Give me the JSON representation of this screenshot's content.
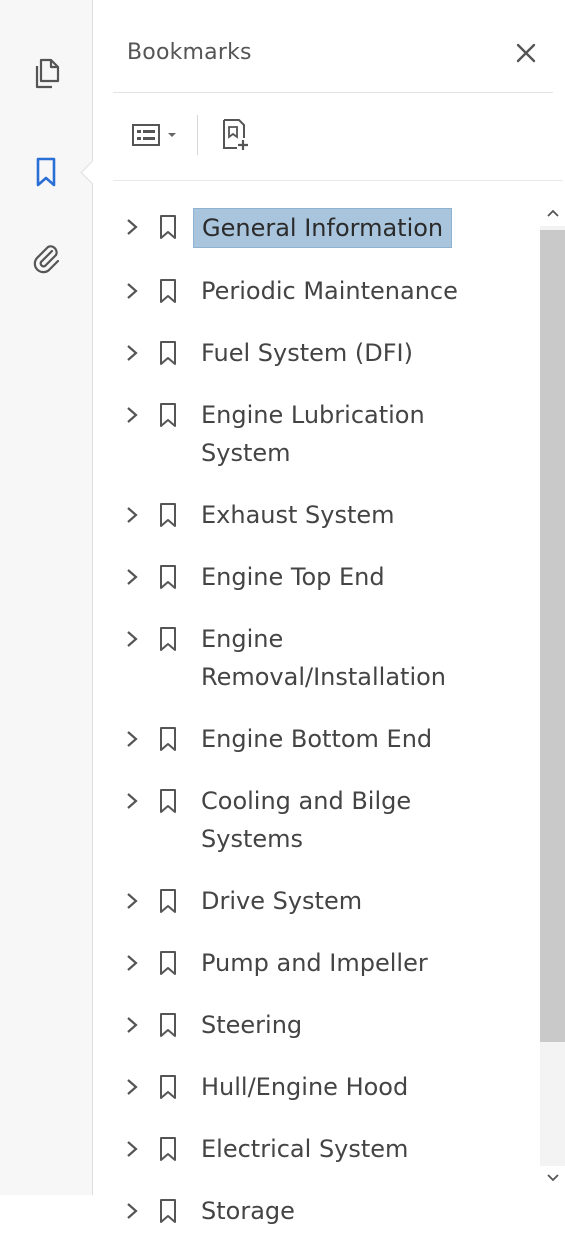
{
  "rail": {
    "items": [
      {
        "icon": "page-thumbnails-icon",
        "active": false
      },
      {
        "icon": "bookmark-icon",
        "active": true,
        "color": "#2a6fd6"
      },
      {
        "icon": "attachment-icon",
        "active": false
      }
    ]
  },
  "panel": {
    "title": "Bookmarks",
    "close_icon": "close-icon"
  },
  "toolbar": {
    "options_icon": "list-options-icon",
    "add_icon": "new-bookmark-icon"
  },
  "bookmarks": [
    {
      "label": "General Information",
      "selected": true
    },
    {
      "label": "Periodic Maintenance"
    },
    {
      "label": "Fuel System (DFI)"
    },
    {
      "label": "Engine Lubrication System"
    },
    {
      "label": "Exhaust System"
    },
    {
      "label": "Engine Top End"
    },
    {
      "label": "Engine Removal/Installation"
    },
    {
      "label": "Engine Bottom End"
    },
    {
      "label": "Cooling and Bilge Systems"
    },
    {
      "label": "Drive System"
    },
    {
      "label": "Pump and Impeller"
    },
    {
      "label": "Steering"
    },
    {
      "label": "Hull/Engine Hood"
    },
    {
      "label": "Electrical System"
    },
    {
      "label": "Storage"
    }
  ],
  "colors": {
    "selected_bg": "#a9c5dd",
    "accent": "#2a6fd6"
  }
}
